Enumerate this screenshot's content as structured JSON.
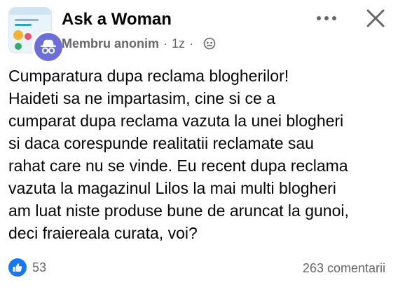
{
  "group": {
    "name": "Ask a Woman"
  },
  "post": {
    "author": "Membru anonim",
    "separator": "·",
    "time": "1z",
    "text": "Cumparatura dupa reclama blogherilor!\nHaideti sa ne impartasim, cine si ce a\ncumparat dupa reclama vazuta la unei blogheri\nsi daca corespunde realitatii reclamate sau\nrahat care nu se vinde. Eu recent dupa reclama\nvazuta la magazinul Lilos la mai multi blogheri\nam luat niste produse bune de aruncat la gunoi,\ndeci fraiereala curata, voi?",
    "reaction_count": "53",
    "comments_label": "263 comentarii"
  },
  "icons": {
    "more": "more-horizontal-icon",
    "close": "close-icon",
    "audience": "group-audience-icon",
    "like": "like-icon",
    "anonymous": "anonymous-user-icon"
  },
  "colors": {
    "accent": "#1877f2",
    "secondary_text": "#65676b",
    "anon_avatar": "#6b6fd6"
  }
}
